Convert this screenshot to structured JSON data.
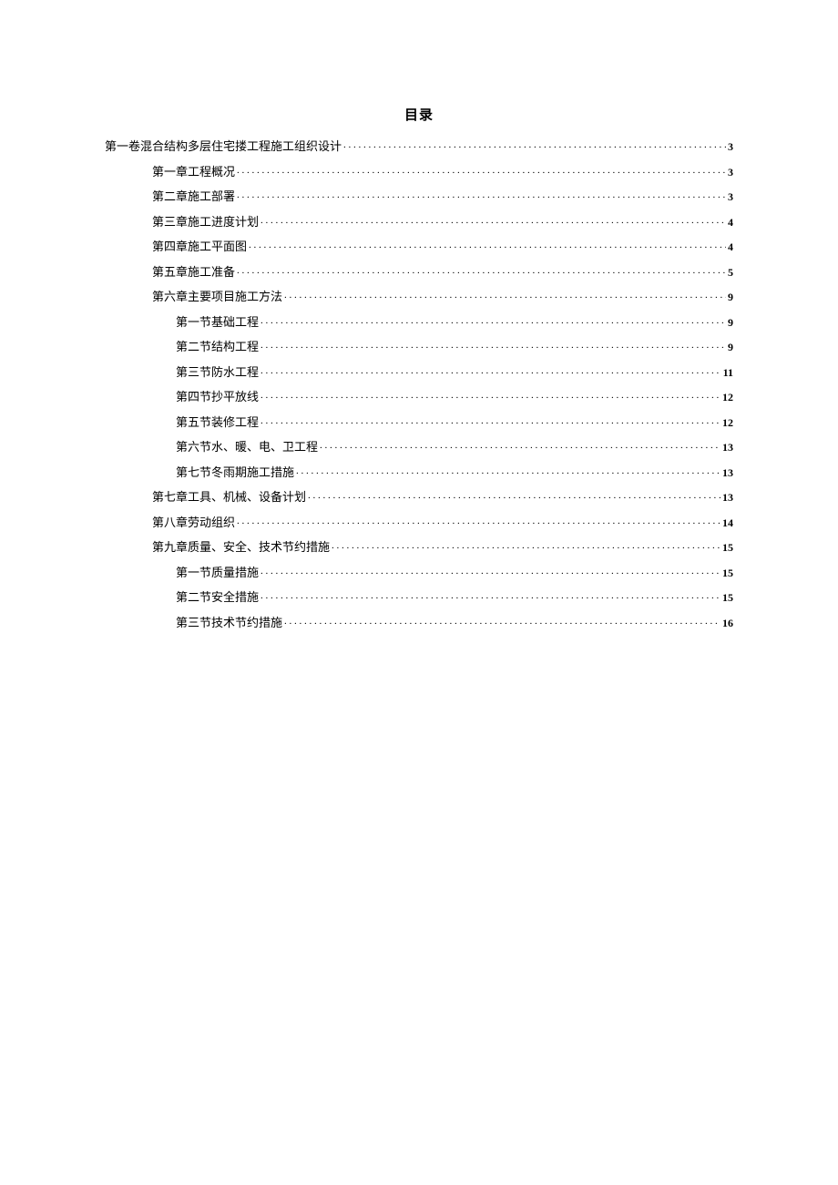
{
  "title": "目录",
  "toc": [
    {
      "level": 0,
      "label": "第一卷混合结构多层住宅搂工程施工组织设计",
      "page": "3"
    },
    {
      "level": 1,
      "label": "第一章工程概况",
      "page": "3"
    },
    {
      "level": 1,
      "label": "第二章施工部署",
      "page": "3"
    },
    {
      "level": 1,
      "label": "第三章施工进度计划",
      "page": "4"
    },
    {
      "level": 1,
      "label": "第四章施工平面图",
      "page": "4"
    },
    {
      "level": 1,
      "label": "第五章施工准备",
      "page": "5"
    },
    {
      "level": 1,
      "label": "第六章主要项目施工方法",
      "page": "9"
    },
    {
      "level": 2,
      "label": "第一节基础工程",
      "page": "9"
    },
    {
      "level": 2,
      "label": "第二节结构工程",
      "page": "9"
    },
    {
      "level": 2,
      "label": "第三节防水工程",
      "page": "11"
    },
    {
      "level": 2,
      "label": "第四节抄平放线",
      "page": "12"
    },
    {
      "level": 2,
      "label": "第五节装修工程",
      "page": "12"
    },
    {
      "level": 2,
      "label": "第六节水、暖、电、卫工程",
      "page": "13"
    },
    {
      "level": 2,
      "label": "第七节冬雨期施工措施",
      "page": "13"
    },
    {
      "level": 1,
      "label": "第七章工具、机械、设备计划",
      "page": "13"
    },
    {
      "level": 1,
      "label": "第八章劳动组织",
      "page": "14"
    },
    {
      "level": 1,
      "label": "第九章质量、安全、技术节约措施",
      "page": "15"
    },
    {
      "level": 2,
      "label": "第一节质量措施",
      "page": "15"
    },
    {
      "level": 2,
      "label": "第二节安全措施",
      "page": "15"
    },
    {
      "level": 2,
      "label": "第三节技术节约措施",
      "page": "16"
    }
  ]
}
